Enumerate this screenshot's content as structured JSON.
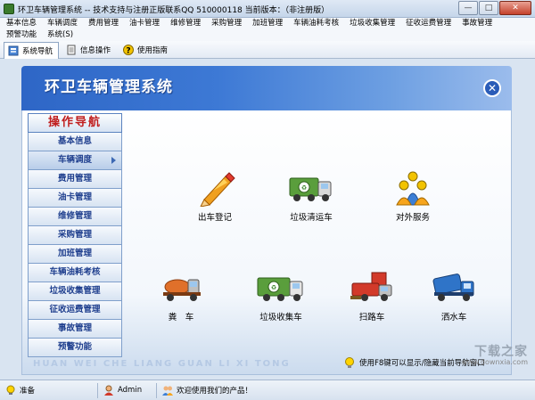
{
  "window": {
    "title": "环卫车辆管理系统 -- 技术支持与注册正版联系QQ 510000118   当前版本：（非注册版）",
    "buttons": {
      "minimize": "—",
      "restore": "□",
      "close": "✕"
    }
  },
  "menu": {
    "row1": [
      "基本信息",
      "车辆调度",
      "费用管理",
      "油卡管理",
      "维修管理",
      "采购管理",
      "加班管理",
      "车辆油耗考核",
      "垃圾收集管理",
      "征收运费管理",
      "事故管理"
    ],
    "row2": [
      "预警功能",
      "系统(S)"
    ]
  },
  "toolbar": {
    "items": [
      {
        "label": "系统导航",
        "icon": "navigation-icon"
      },
      {
        "label": "信息操作",
        "icon": "document-icon"
      },
      {
        "label": "使用指南",
        "icon": "help-icon"
      }
    ]
  },
  "banner": {
    "title": "环卫车辆管理系统"
  },
  "nav": {
    "header": "操作导航",
    "items": [
      "基本信息",
      "车辆调度",
      "费用管理",
      "油卡管理",
      "维修管理",
      "采购管理",
      "加班管理",
      "车辆油耗考核",
      "垃圾收集管理",
      "征收运费管理",
      "事故管理",
      "预警功能"
    ],
    "selected": 1
  },
  "features": [
    {
      "label": "出车登记",
      "icon": "pencil-icon"
    },
    {
      "label": "垃圾清运车",
      "icon": "garbage-truck-icon"
    },
    {
      "label": "对外服务",
      "icon": "service-people-icon"
    },
    {
      "label": "粪　车",
      "icon": "sewage-truck-icon"
    },
    {
      "label": "垃圾收集车",
      "icon": "collection-truck-icon"
    },
    {
      "label": "扫路车",
      "icon": "sweeper-truck-icon"
    },
    {
      "label": "洒水车",
      "icon": "water-truck-icon"
    }
  ],
  "watermark": "HUAN WEI CHE LIANG GUAN LI XI TONG",
  "hint": "使用F8键可以显示/隐藏当前导航窗口",
  "status": {
    "state": "准备",
    "user": "Admin",
    "message": "欢迎使用我们的产品！"
  },
  "site_watermark": {
    "big": "下载之家",
    "small": "www.downxia.com"
  },
  "colors": {
    "banner": "#3d79d5",
    "nav_header_text": "#c01e1e",
    "nav_text": "#1f3f8e",
    "background": "#d9e4f1"
  }
}
